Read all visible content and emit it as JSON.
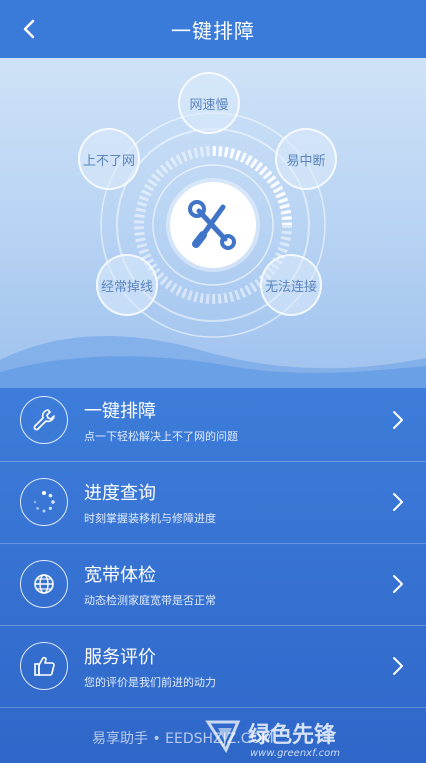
{
  "header": {
    "title": "一键排障",
    "back_icon": "chevron-left-icon"
  },
  "hero": {
    "bubbles": [
      "网速慢",
      "易中断",
      "无法连接",
      "经常掉线",
      "上不了网"
    ],
    "center_icon": "tools-icon"
  },
  "menu": {
    "items": [
      {
        "title": "一键排障",
        "subtitle": "点一下轻松解决上不了网的问题",
        "icon": "wrench-icon"
      },
      {
        "title": "进度查询",
        "subtitle": "时刻掌握装移机与修障进度",
        "icon": "loading-icon"
      },
      {
        "title": "宽带体检",
        "subtitle": "动态检测家庭宽带是否正常",
        "icon": "globe-icon"
      },
      {
        "title": "服务评价",
        "subtitle": "您的评价是我们前进的动力",
        "icon": "thumbs-up-icon"
      }
    ]
  },
  "watermark": {
    "text": "易享助手 • EEDSHZJZ.COM",
    "logo_text": "绿色先锋",
    "logo_url": "www.greenxf.com"
  },
  "colors": {
    "primary": "#3a7ad8",
    "bubble_text": "#5b84bc",
    "icon_blue": "#3f74c9"
  }
}
